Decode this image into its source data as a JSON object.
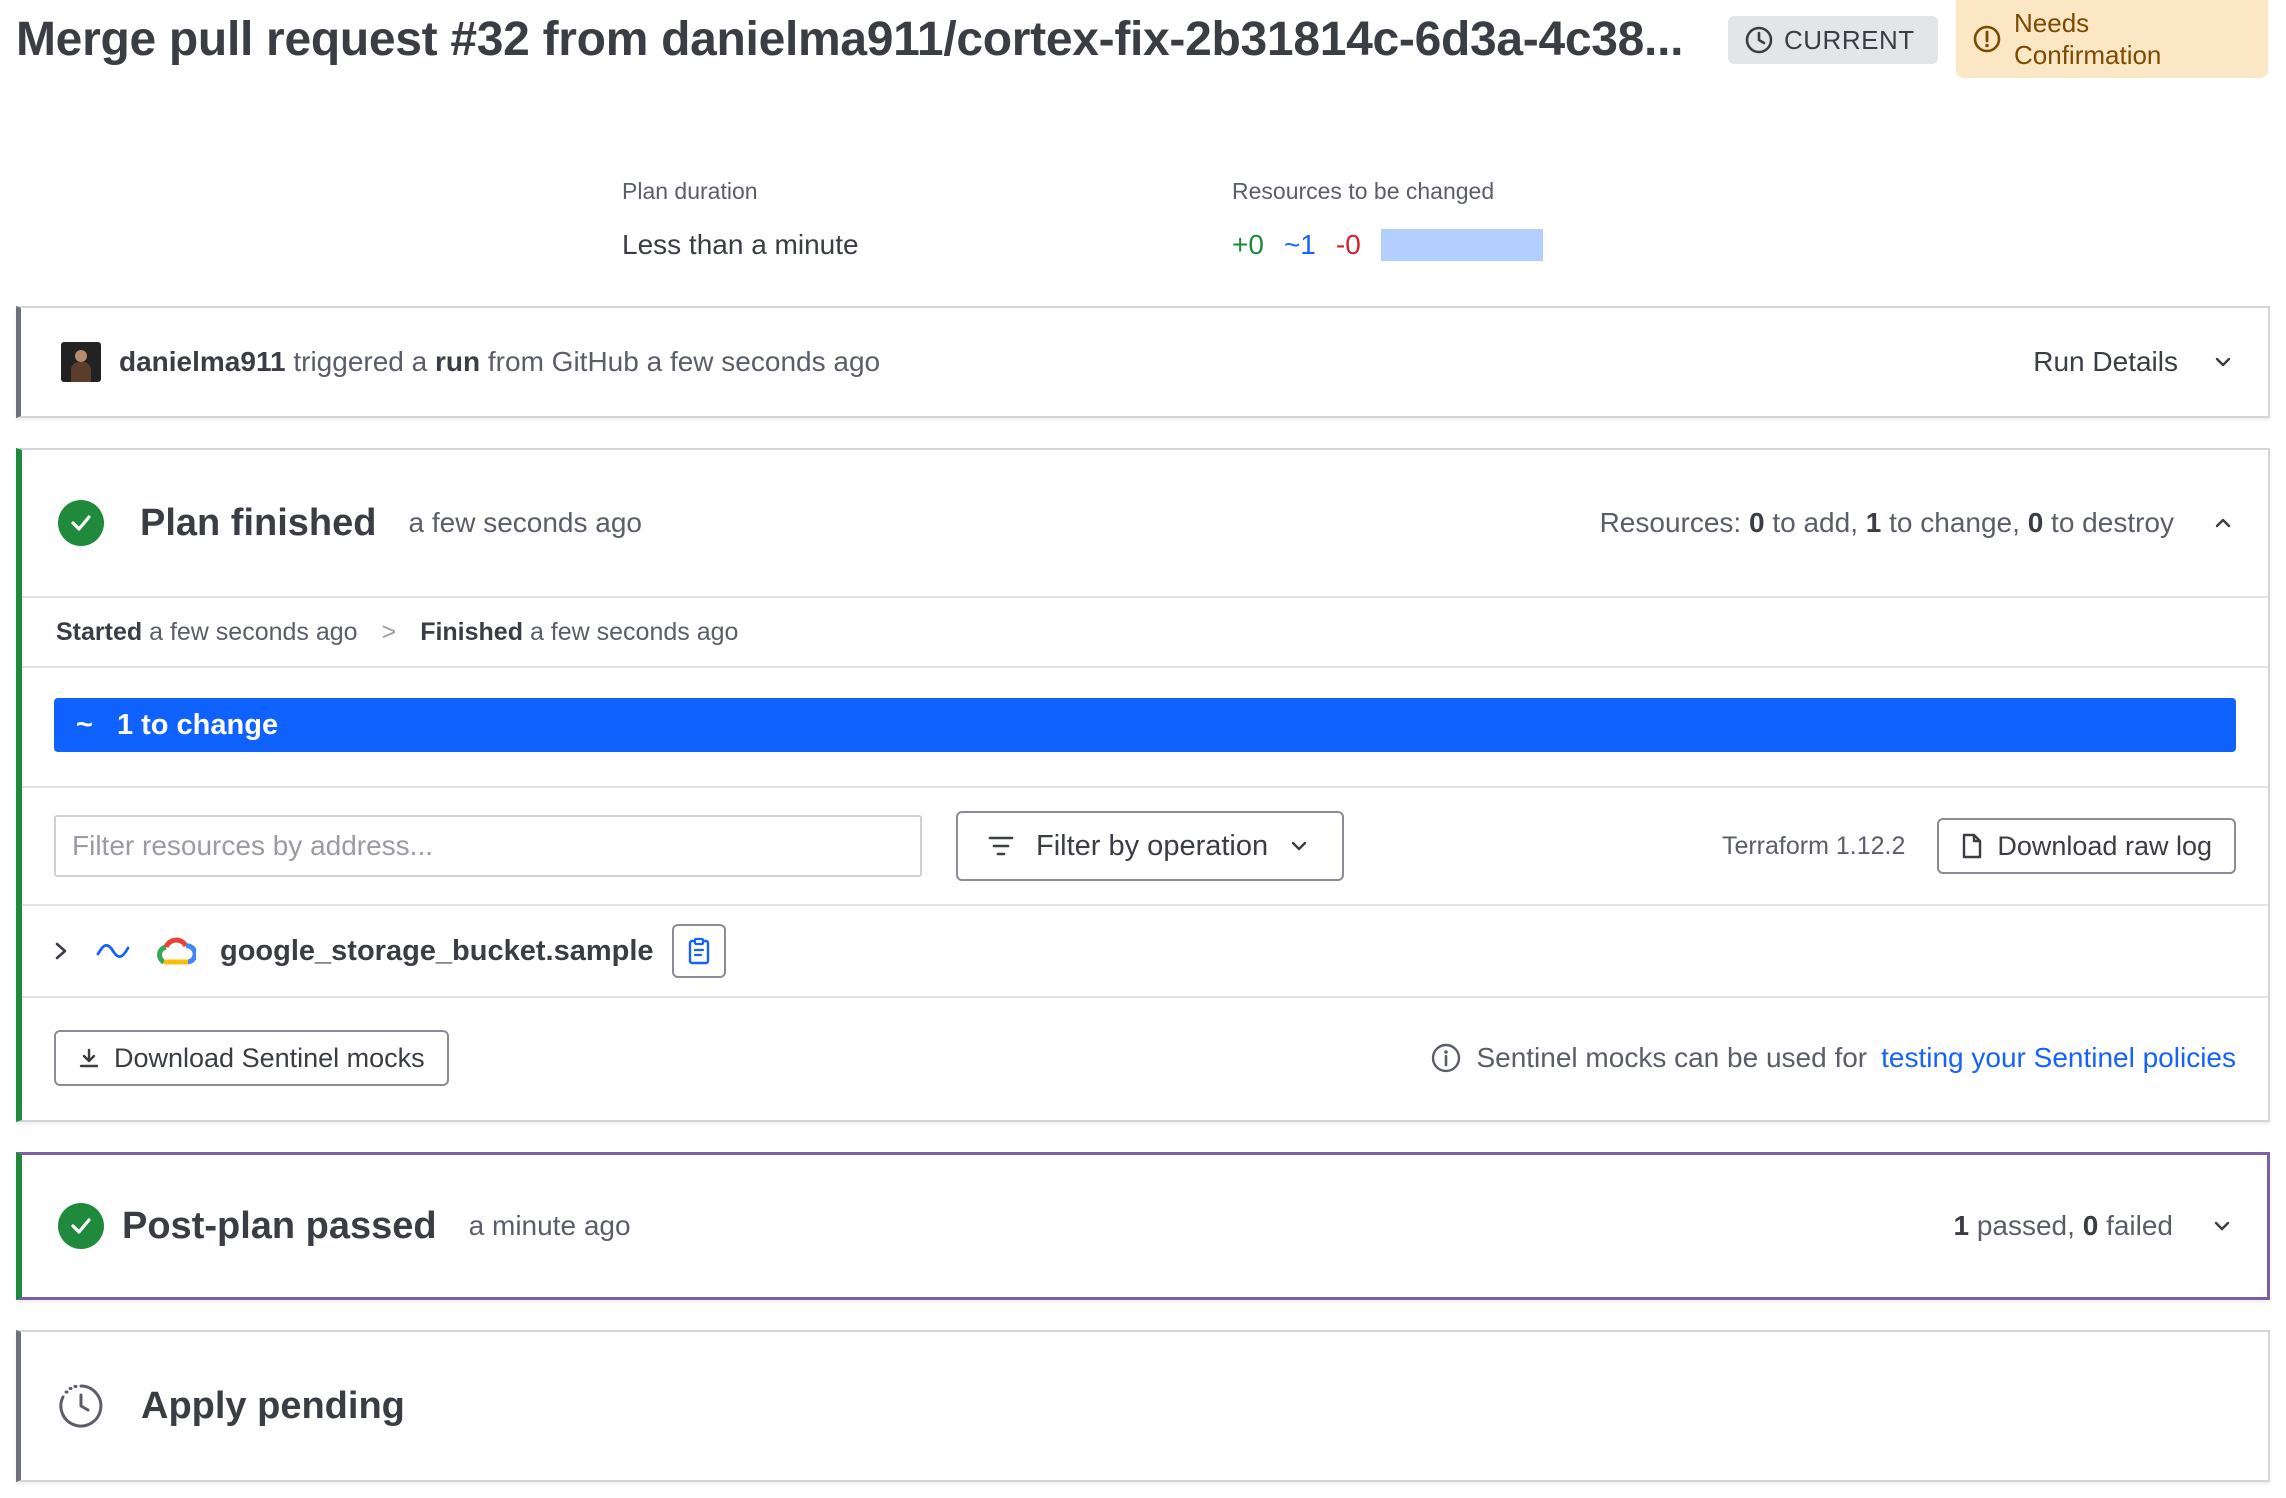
{
  "header": {
    "title": "Merge pull request #32 from danielma911/cortex-fix-2b31814c-6d3a-4c38...",
    "current_badge": "CURRENT",
    "needs_badge_line1": "Needs",
    "needs_badge_line2": "Confirmation"
  },
  "stats": {
    "plan_duration_label": "Plan duration",
    "plan_duration_value": "Less than a minute",
    "resources_label": "Resources to be changed",
    "add": "+0",
    "change": "~1",
    "destroy": "-0"
  },
  "trigger": {
    "user": "danielma911",
    "text1": "triggered a",
    "run_word": "run",
    "text2": "from GitHub a few seconds ago",
    "run_details": "Run Details"
  },
  "plan": {
    "title": "Plan finished",
    "time": "a few seconds ago",
    "resources_prefix": "Resources:",
    "add_count": "0",
    "add_text": "to add,",
    "change_count": "1",
    "change_text": "to change,",
    "destroy_count": "0",
    "destroy_text": "to destroy",
    "started_label": "Started",
    "started_time": "a few seconds ago",
    "finished_label": "Finished",
    "finished_time": "a few seconds ago",
    "change_bar_icon": "~",
    "change_bar_label": "1 to change",
    "filter_placeholder": "Filter resources by address...",
    "filter_op_label": "Filter by operation",
    "terraform_version": "Terraform 1.12.2",
    "download_raw_log": "Download raw log",
    "resource_name": "google_storage_bucket.sample",
    "download_mocks": "Download Sentinel mocks",
    "mocks_note": "Sentinel mocks can be used for",
    "mocks_link": "testing your Sentinel policies"
  },
  "postplan": {
    "title": "Post-plan passed",
    "time": "a minute ago",
    "passed_count": "1",
    "passed_text": "passed,",
    "failed_count": "0",
    "failed_text": "failed"
  },
  "apply": {
    "title": "Apply pending"
  },
  "colors": {
    "success": "#1f8a3b",
    "change_blue": "#0f62fe",
    "destroy_red": "#d6222f",
    "warning_bg": "#fbe7c3"
  }
}
